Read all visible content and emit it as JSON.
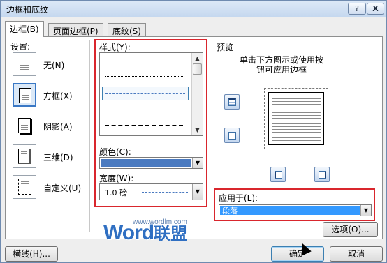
{
  "window": {
    "title": "边框和底纹",
    "help_label": "?",
    "close_label": "X"
  },
  "tabs": [
    {
      "label": "边框(B)",
      "active": true
    },
    {
      "label": "页面边框(P)",
      "active": false
    },
    {
      "label": "底纹(S)",
      "active": false
    }
  ],
  "settings": {
    "label": "设置:",
    "items": [
      {
        "label": "无(N)",
        "icon": "no-border-icon",
        "selected": false
      },
      {
        "label": "方框(X)",
        "icon": "box-border-icon",
        "selected": true
      },
      {
        "label": "阴影(A)",
        "icon": "shadow-border-icon",
        "selected": false
      },
      {
        "label": "三维(D)",
        "icon": "3d-border-icon",
        "selected": false
      },
      {
        "label": "自定义(U)",
        "icon": "custom-border-icon",
        "selected": false
      }
    ]
  },
  "style": {
    "label": "样式(Y):",
    "options": [
      "solid",
      "dotted",
      "dash-dot-fine",
      "dashed",
      "long-dashed"
    ],
    "selected_index": 2
  },
  "color": {
    "label": "颜色(C):",
    "value_color": "#4a7ac0"
  },
  "width": {
    "label": "宽度(W):",
    "value": "1.0 磅"
  },
  "preview": {
    "label": "预览",
    "instruction": "单击下方图示或使用按钮可应用边框"
  },
  "apply_to": {
    "label": "应用于(L):",
    "value": "段落"
  },
  "buttons": {
    "options": "选项(O)...",
    "horizontal_line": "横线(H)...",
    "ok": "确定",
    "cancel": "取消"
  },
  "watermark": {
    "url": "www.wordlm.com",
    "word": "Word",
    "cn": "联盟"
  },
  "colors": {
    "accent": "#3a78c5",
    "highlight_red": "#d9262d",
    "selection_blue": "#3399ff"
  }
}
